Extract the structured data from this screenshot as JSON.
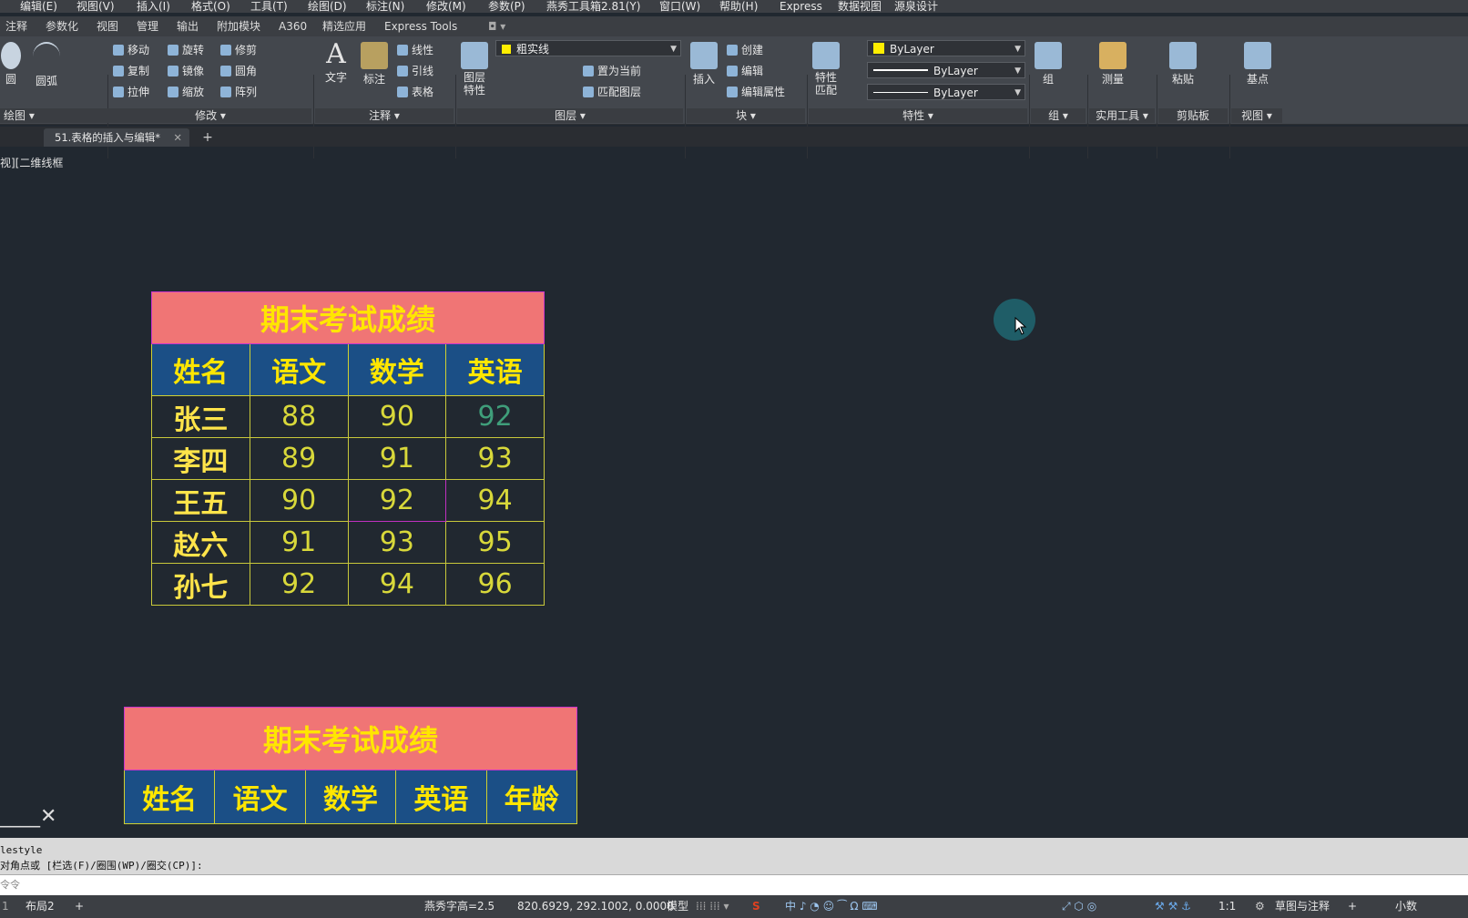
{
  "menubar": [
    "编辑(E)",
    "视图(V)",
    "插入(I)",
    "格式(O)",
    "工具(T)",
    "绘图(D)",
    "标注(N)",
    "修改(M)",
    "参数(P)",
    "燕秀工具箱2.81(Y)",
    "窗口(W)",
    "帮助(H)",
    "Express",
    "数据视图",
    "源泉设计"
  ],
  "ribbon_tabs": [
    "注释",
    "参数化",
    "视图",
    "管理",
    "输出",
    "附加模块",
    "A360",
    "精选应用",
    "Express Tools"
  ],
  "ribbon": {
    "draw": {
      "circle": "圆",
      "arc": "圆弧",
      "title": "绘图"
    },
    "modify": {
      "move": "移动",
      "rotate": "旋转",
      "trim": "修剪",
      "copy": "复制",
      "mirror": "镜像",
      "fillet": "圆角",
      "stretch": "拉伸",
      "scale": "缩放",
      "array": "阵列",
      "title": "修改"
    },
    "annotate": {
      "text": "文字",
      "dim": "标注",
      "linear": "线性",
      "leader": "引线",
      "table": "表格",
      "title": "注释"
    },
    "layers": {
      "layer_props": "图层\n特性",
      "layer_combo": "粗实线",
      "set_current": "置为当前",
      "match_layer": "匹配图层",
      "title": "图层"
    },
    "block": {
      "insert": "插入",
      "create": "创建",
      "edit": "编辑",
      "edit_attr": "编辑属性",
      "title": "块"
    },
    "properties": {
      "match": "特性\n匹配",
      "color": "ByLayer",
      "linetype": "ByLayer",
      "lineweight": "ByLayer",
      "title": "特性"
    },
    "group": {
      "group": "组",
      "title": "组"
    },
    "utilities": {
      "measure": "测量",
      "title": "实用工具"
    },
    "clipboard": {
      "paste": "粘贴",
      "title": "剪贴板"
    },
    "view": {
      "base": "基点",
      "title": "视图"
    }
  },
  "doc_tab": "51.表格的插入与编辑*",
  "view_label": "视][二维线框",
  "table1": {
    "title": "期末考试成绩",
    "headers": [
      "姓名",
      "语文",
      "数学",
      "英语"
    ],
    "rows": [
      [
        "张三",
        "88",
        "90",
        "92"
      ],
      [
        "李四",
        "89",
        "91",
        "93"
      ],
      [
        "王五",
        "90",
        "92",
        "94"
      ],
      [
        "赵六",
        "91",
        "93",
        "95"
      ],
      [
        "孙七",
        "92",
        "94",
        "96"
      ]
    ]
  },
  "table2": {
    "title": "期末考试成绩",
    "headers": [
      "姓名",
      "语文",
      "数学",
      "英语",
      "年龄"
    ]
  },
  "command": {
    "line1": "lestyle",
    "line2": "对角点或 [栏选(F)/圈围(WP)/圈交(CP)]:",
    "prompt": "令令"
  },
  "status": {
    "layout_tab": "布局2",
    "text_height": "燕秀字高=2.5",
    "coords": "820.6929, 292.1002, 0.0000",
    "model": "模型",
    "scale": "1:1",
    "workspace": "草图与注释",
    "units": "小数"
  },
  "colors": {
    "title_bg": "#f07575",
    "header_bg": "#1b4f86",
    "text_yellow": "#ffe600",
    "canvas": "#212830"
  }
}
